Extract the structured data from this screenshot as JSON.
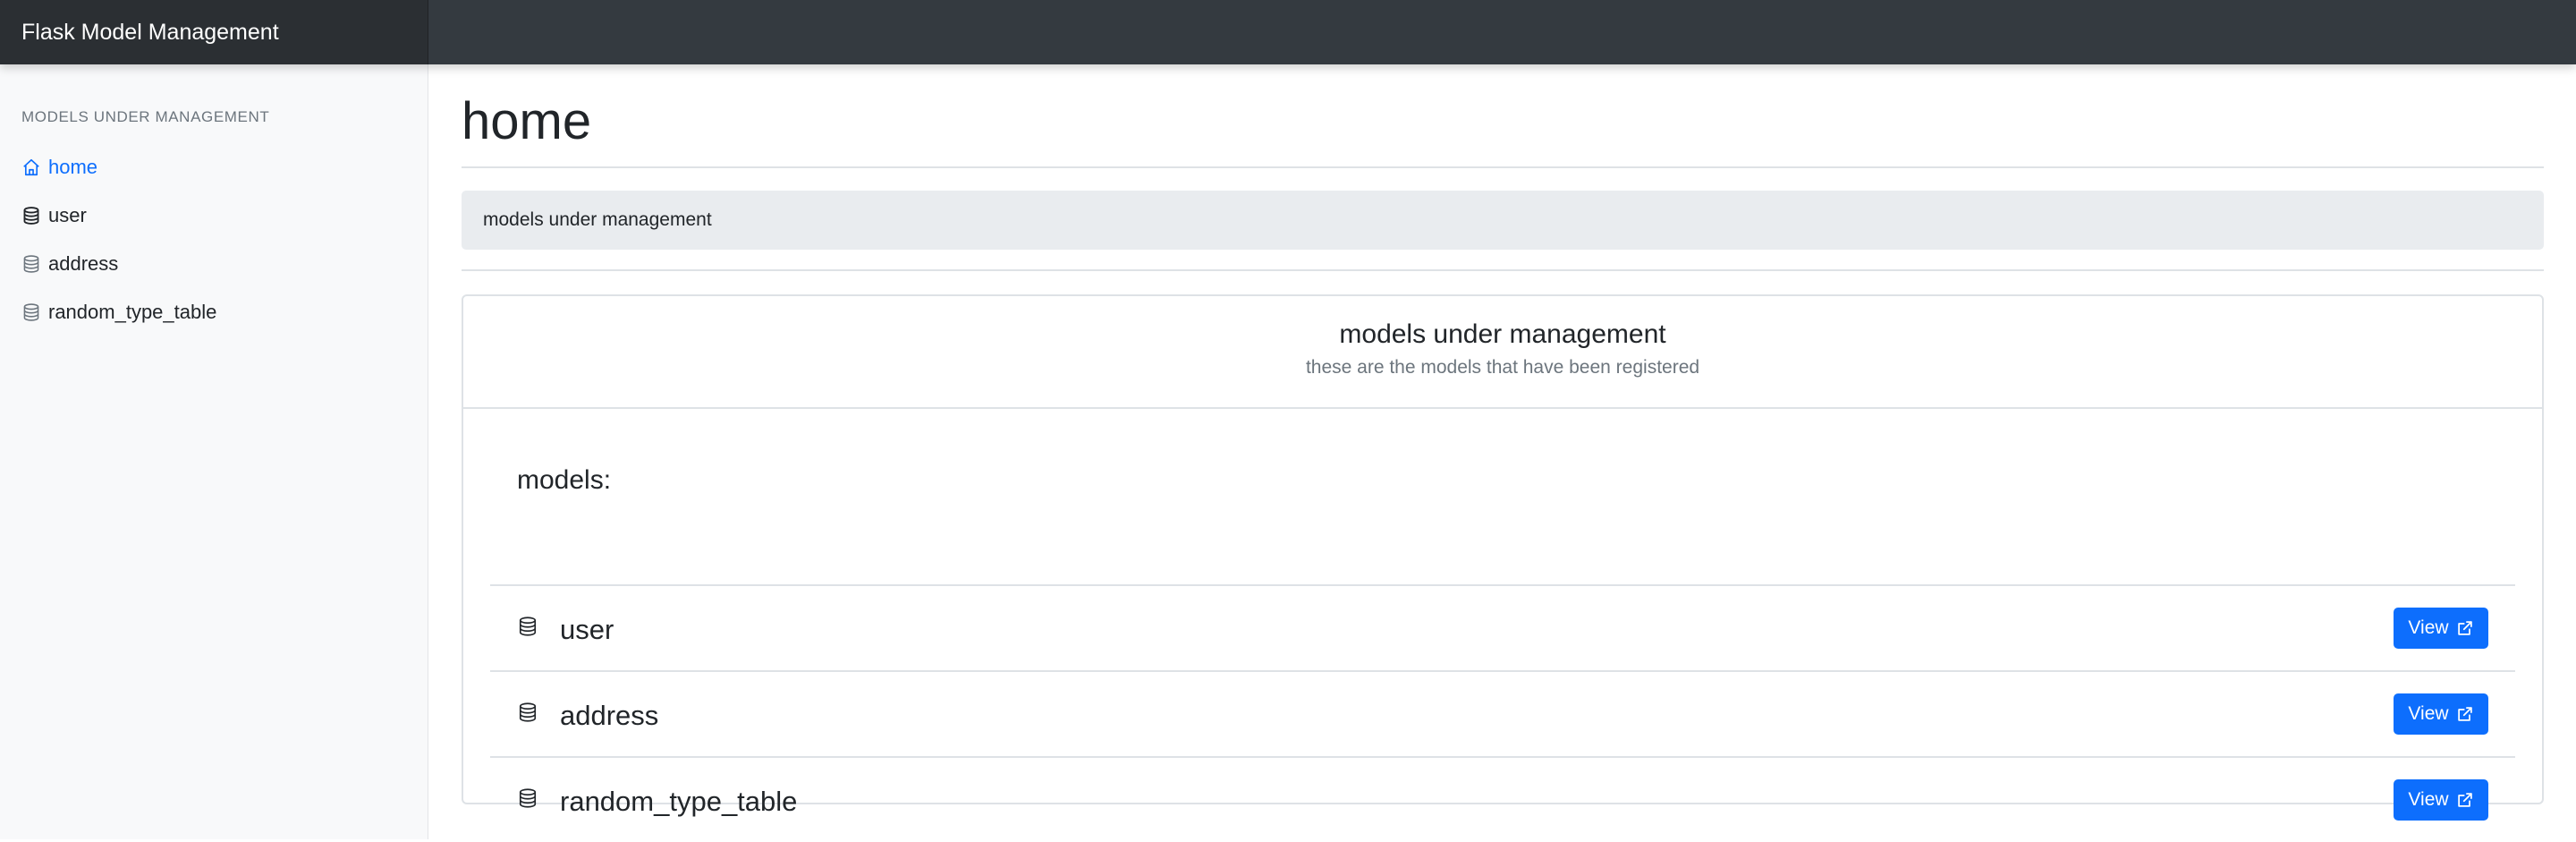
{
  "app": {
    "brand": "Flask Model Management"
  },
  "sidebar": {
    "heading": "Models under management",
    "items": [
      {
        "label": "home",
        "icon": "house-icon",
        "active": true
      },
      {
        "label": "user",
        "icon": "database-icon"
      },
      {
        "label": "address",
        "icon": "database-icon"
      },
      {
        "label": "random_type_table",
        "icon": "database-icon"
      }
    ]
  },
  "main": {
    "title": "home",
    "breadcrumb": "models under management",
    "card": {
      "title": "models under management",
      "subtitle": "these are the models that have been registered",
      "list_heading": "models:",
      "models": [
        {
          "name": "user",
          "action": "View"
        },
        {
          "name": "address",
          "action": "View"
        },
        {
          "name": "random_type_table",
          "action": "View"
        }
      ]
    }
  },
  "colors": {
    "accent": "#0d6efd",
    "topbar": "#343a40",
    "sidebar_bg": "#f8f9fa",
    "breadcrumb_bg": "#e9ecef"
  }
}
